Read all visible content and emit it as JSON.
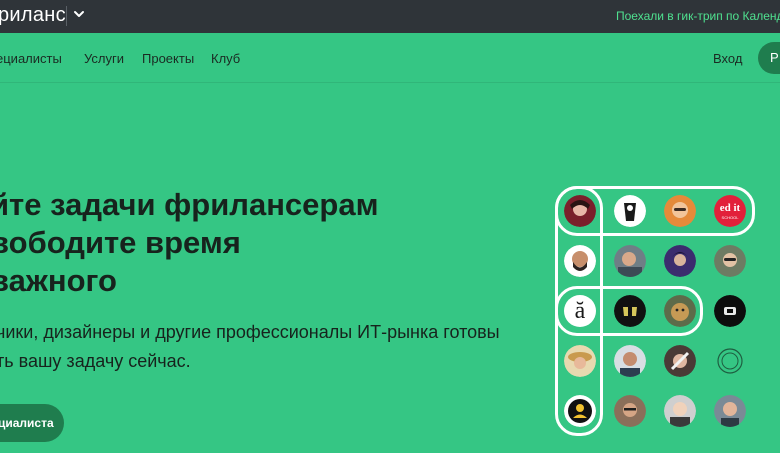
{
  "header": {
    "brand": "риланс",
    "promo": "Поехали в гик-трип по Календар"
  },
  "nav": {
    "items": [
      "ециалисты",
      "Услуги",
      "Проекты",
      "Клуб"
    ],
    "login": "Вход",
    "register": "Р"
  },
  "hero": {
    "title_lines": [
      "йте задачи фрилансерам",
      "вободите время",
      "важного"
    ],
    "subtitle_lines": [
      "чики, дизайнеры и другие профессионалы ИТ-рынка готовы",
      "ть вашу задачу сейчас."
    ],
    "cta": "циалиста"
  },
  "avatars": {
    "letter_avatar": "ă",
    "edit_avatar": "ed it",
    "edit_sub": "SCHOOL",
    "colors": {
      "accent": "#35c684",
      "dark": "#2f3439",
      "button": "#1f7d4e",
      "promo": "#4fe08f"
    }
  }
}
